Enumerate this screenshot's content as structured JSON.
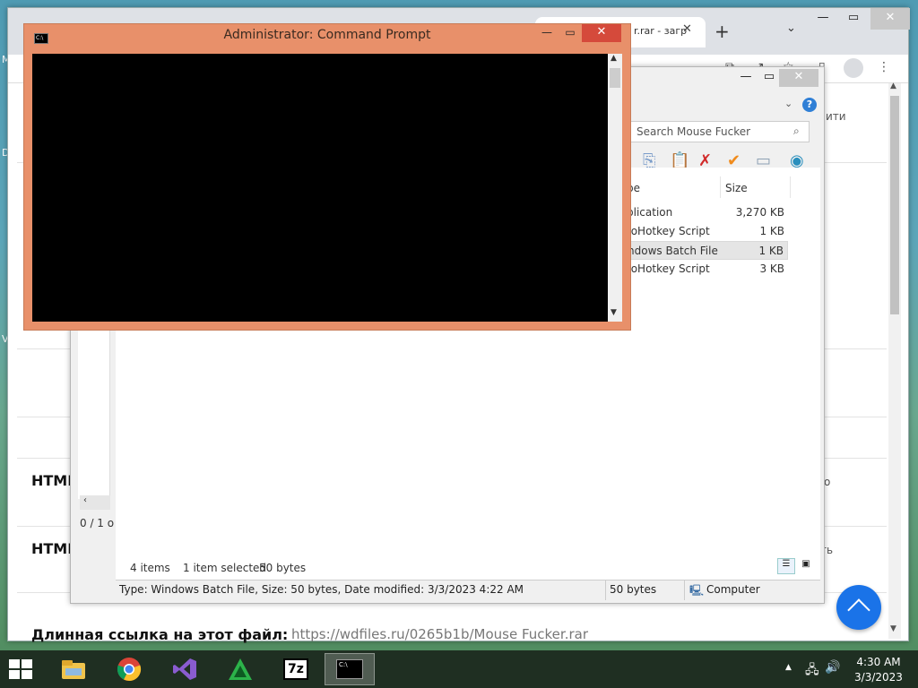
{
  "desktop": {
    "edge_letters": [
      "M",
      "D",
      "V"
    ]
  },
  "browser": {
    "tab_title": "r.rar - загр",
    "right_partial_texts": {
      "top": "ити",
      "html": "о",
      "html_code": "ть"
    }
  },
  "page": {
    "rows": [
      {
        "label": "HTML",
        "value": ""
      },
      {
        "label": "HTML Code",
        "value": ""
      },
      {
        "label": "Длинная ссылка на этот файл:",
        "value": "https://wdfiles.ru/0265b1b/Mouse Fucker.rar"
      }
    ]
  },
  "archive": {
    "search_placeholder": "Search Mouse Fucker",
    "columns": {
      "type": "pe",
      "size": "Size"
    },
    "files": [
      {
        "type": "plication",
        "size": "3,270 KB",
        "selected": false
      },
      {
        "type": "toHotkey Script",
        "size": "1 KB",
        "selected": false
      },
      {
        "type": "ndows Batch File",
        "size": "1 KB",
        "selected": true
      },
      {
        "type": "toHotkey Script",
        "size": "3 KB",
        "selected": false
      }
    ],
    "left_status": "0 / 1 o",
    "status_items": "4 items",
    "status_selected": "1 item selected",
    "status_bytes": "50 bytes",
    "details": "Type: Windows Batch File, Size: 50 bytes, Date modified: 3/3/2023 4:22 AM",
    "details_size": "50 bytes",
    "details_location": "Computer"
  },
  "cmd": {
    "title": "Administrator:  Command Prompt",
    "icon_text": "C:\\"
  },
  "taskbar": {
    "time": "4:30 AM",
    "date": "3/3/2023",
    "seven_zip_label": "7z"
  },
  "colors": {
    "cmd_frame": "#e8906a",
    "cmd_close": "#d54a3b",
    "scroll_top_button": "#1a73e8",
    "taskbar": "#1f2f22"
  }
}
